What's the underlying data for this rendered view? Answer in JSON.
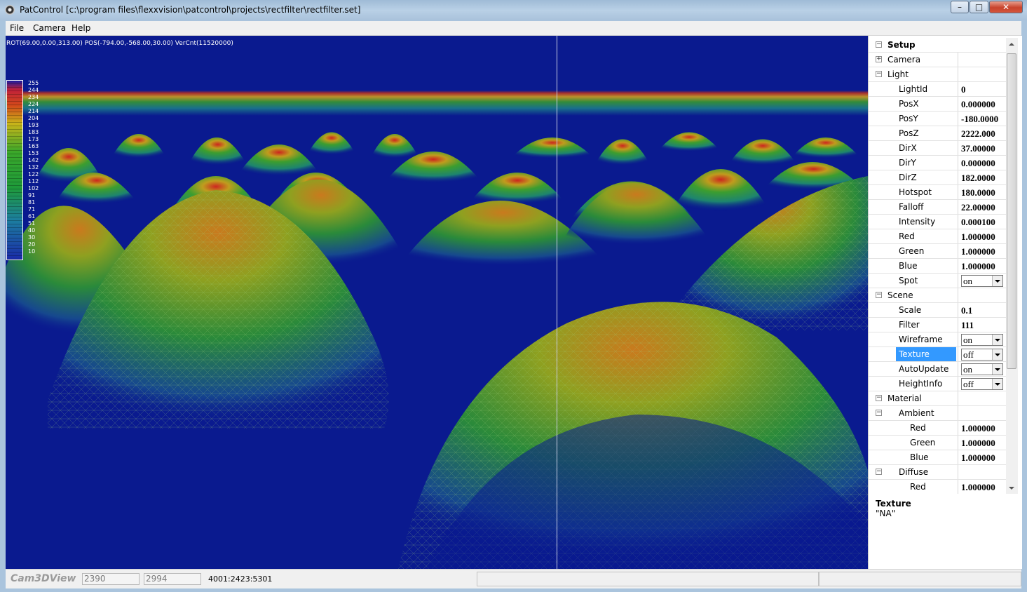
{
  "window": {
    "title": "PatControl [c:\\program files\\flexxvision\\patcontrol\\projects\\rectfilter\\rectfilter.set]"
  },
  "caption_buttons": {
    "minimize": "–",
    "maximize": "□",
    "close": "✕"
  },
  "menu": [
    "File",
    "Camera",
    "Help"
  ],
  "viewport": {
    "hud": "ROT(69.00,0.00,313.00) POS(-794.00,-568.00,30.00) VerCnt(11520000)",
    "legend": [
      "255",
      "244",
      "234",
      "224",
      "214",
      "204",
      "193",
      "183",
      "173",
      "163",
      "153",
      "142",
      "132",
      "122",
      "112",
      "102",
      "91",
      "81",
      "71",
      "61",
      "51",
      "40",
      "30",
      "20",
      "10"
    ]
  },
  "properties": {
    "setup": "Setup",
    "camera": "Camera",
    "light": "Light",
    "light_rows": [
      {
        "name": "LightId",
        "value": "0"
      },
      {
        "name": "PosX",
        "value": "0.000000"
      },
      {
        "name": "PosY",
        "value": "-180.0000"
      },
      {
        "name": "PosZ",
        "value": "2222.000"
      },
      {
        "name": "DirX",
        "value": "37.00000"
      },
      {
        "name": "DirY",
        "value": "0.000000"
      },
      {
        "name": "DirZ",
        "value": "182.0000"
      },
      {
        "name": "Hotspot",
        "value": "180.0000"
      },
      {
        "name": "Falloff",
        "value": "22.00000"
      },
      {
        "name": "Intensity",
        "value": "0.000100"
      },
      {
        "name": "Red",
        "value": "1.000000"
      },
      {
        "name": "Green",
        "value": "1.000000"
      },
      {
        "name": "Blue",
        "value": "1.000000"
      },
      {
        "name": "Spot",
        "value": "on"
      }
    ],
    "scene": "Scene",
    "scene_rows": [
      {
        "name": "Scale",
        "value": "0.1"
      },
      {
        "name": "Filter",
        "value": "111"
      },
      {
        "name": "Wireframe",
        "value": "on"
      },
      {
        "name": "Texture",
        "value": "off"
      },
      {
        "name": "AutoUpdate",
        "value": "on"
      },
      {
        "name": "HeightInfo",
        "value": "off"
      }
    ],
    "material": "Material",
    "ambient": "Ambient",
    "ambient_rows": [
      {
        "name": "Red",
        "value": "1.000000"
      },
      {
        "name": "Green",
        "value": "1.000000"
      },
      {
        "name": "Blue",
        "value": "1.000000"
      }
    ],
    "diffuse": "Diffuse",
    "diffuse_rows": [
      {
        "name": "Red",
        "value": "1.000000"
      }
    ],
    "description_title": "Texture",
    "description_text": "\"NA\""
  },
  "status": {
    "label": "Cam3DView",
    "field1": "2390",
    "field2": "2994",
    "info": "4001:2423:5301"
  }
}
